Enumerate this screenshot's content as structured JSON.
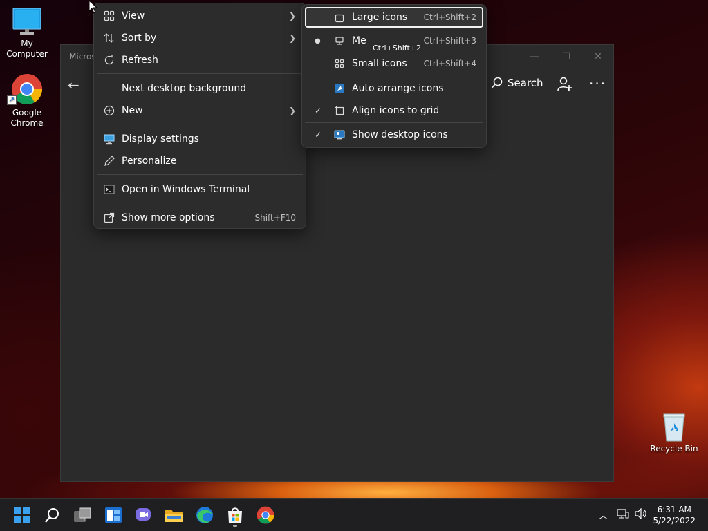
{
  "desktop": {
    "icons": [
      {
        "label": "My Computer",
        "icon": "monitor-icon"
      },
      {
        "label": "Google Chrome",
        "icon": "chrome-icon"
      },
      {
        "label": "Recycle Bin",
        "icon": "recycle-bin-icon"
      }
    ]
  },
  "window": {
    "title": "Micros",
    "search_label": "Search"
  },
  "context_menu": {
    "items": [
      {
        "label": "View",
        "icon": "grid-icon",
        "has_submenu": true
      },
      {
        "label": "Sort by",
        "icon": "sort-icon",
        "has_submenu": true
      },
      {
        "label": "Refresh",
        "icon": "refresh-icon"
      },
      {
        "label": "Next desktop background"
      },
      {
        "label": "New",
        "icon": "plus-circle-icon",
        "has_submenu": true
      },
      {
        "label": "Display settings",
        "icon": "display-icon"
      },
      {
        "label": "Personalize",
        "icon": "pen-icon"
      },
      {
        "label": "Open in Windows Terminal",
        "icon": "terminal-icon"
      },
      {
        "label": "Show more options",
        "icon": "open-external-icon",
        "shortcut": "Shift+F10"
      }
    ]
  },
  "view_submenu": {
    "items": [
      {
        "label": "Large icons",
        "shortcut": "Ctrl+Shift+2",
        "icon": "large-square-icon",
        "state": "highlighted"
      },
      {
        "label": "Medium icons",
        "shortcut": "Ctrl+Shift+3",
        "icon": "monitor-small-icon",
        "state": "selected-bullet"
      },
      {
        "label": "Small icons",
        "shortcut": "Ctrl+Shift+4",
        "icon": "small-grid-icon"
      },
      {
        "label": "Auto arrange icons",
        "icon": "auto-arrange-icon"
      },
      {
        "label": "Align icons to grid",
        "icon": "align-grid-icon",
        "checked": true
      },
      {
        "label": "Show desktop icons",
        "icon": "desktop-icon",
        "checked": true
      }
    ],
    "tooltip": "Ctrl+Shift+2",
    "visible_medium_label": "Me"
  },
  "taskbar": {
    "apps": [
      "windows-start-icon",
      "search-icon",
      "task-view-icon",
      "widgets-icon",
      "teams-chat-icon",
      "file-explorer-icon",
      "edge-icon",
      "store-icon",
      "chrome-icon"
    ],
    "clock": {
      "time": "6:31 AM",
      "date": "5/22/2022"
    }
  }
}
